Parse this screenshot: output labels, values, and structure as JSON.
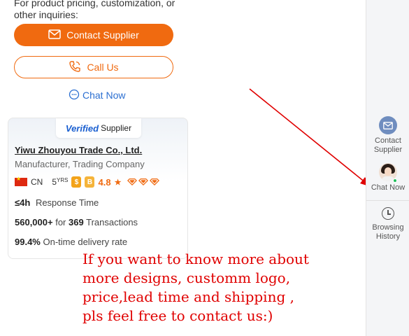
{
  "intro": {
    "line1": "For product pricing, customization, or",
    "line2": "other inquiries:"
  },
  "actions": {
    "contact_supplier": "Contact Supplier",
    "call_us": "Call Us",
    "chat_now": "Chat Now"
  },
  "supplier_card": {
    "verified_prefix": "Verified",
    "verified_suffix": "Supplier",
    "company_name": "Yiwu Zhouyou Trade Co., Ltd.",
    "business_type": "Manufacturer, Trading Company",
    "country": "CN",
    "years": "5",
    "years_unit": "YRS",
    "rating": "4.8",
    "rating_star": "★",
    "diamonds": 3,
    "response_time_value": "≤4h",
    "response_time_label": "Response Time",
    "transactions_amount": "560,000+",
    "transactions_for": "for",
    "transactions_count": "369",
    "transactions_label": "Transactions",
    "ontime_rate": "99.4%",
    "ontime_label": "On-time delivery rate"
  },
  "promo_text": {
    "line1": "If you want to know more about",
    "line2": "more designs, customm logo,",
    "line3": "price,lead time and shipping ,",
    "line4": "pls feel free to contact us:)"
  },
  "right_panel": {
    "contact_line1": "Contact",
    "contact_line2": "Supplier",
    "chat_now": "Chat Now",
    "history_line1": "Browsing",
    "history_line2": "History"
  },
  "colors": {
    "accent_orange": "#f06a10",
    "link_blue": "#2b6fd1",
    "annotation_red": "#e00000"
  },
  "icons": [
    "mail-icon",
    "phone-icon",
    "chat-bubble-icon",
    "flag-cn-icon",
    "medal-icon",
    "diamond-icon",
    "clock-icon"
  ]
}
